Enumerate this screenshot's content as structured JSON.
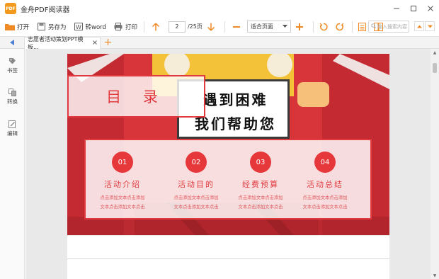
{
  "app": {
    "logo_text": "PDF",
    "title": "金舟PDF阅读器",
    "window_controls": [
      "minimize",
      "maximize",
      "close"
    ]
  },
  "toolbar": {
    "open_label": "打开",
    "save_as_label": "另存为",
    "to_word_label": "转word",
    "print_label": "打印",
    "current_page": "2",
    "total_pages": "/25页",
    "zoom_value": "适合页面",
    "search_placeholder": "输入搜索内容"
  },
  "tabs": {
    "items": [
      {
        "label": "志愿者活动策划PPT模板..."
      }
    ]
  },
  "sidebar": {
    "items": [
      {
        "label": "书签",
        "icon": "bookmark-icon"
      },
      {
        "label": "转换",
        "icon": "convert-icon"
      },
      {
        "label": "编辑",
        "icon": "edit-icon"
      }
    ]
  },
  "slide": {
    "toc_title": "目 录",
    "sign_line1": "遇到困难",
    "sign_line2": "我们帮助您",
    "sections": [
      {
        "num": "01",
        "title": "活动介绍",
        "desc1": "点击添加文本点击添加",
        "desc2": "文本点击添加文本点击"
      },
      {
        "num": "02",
        "title": "活动目的",
        "desc1": "点击添加文本点击添加",
        "desc2": "文本点击添加文本点击"
      },
      {
        "num": "03",
        "title": "经费预算",
        "desc1": "点击添加文本点击添加",
        "desc2": "文本点击添加文本点击"
      },
      {
        "num": "04",
        "title": "活动总结",
        "desc1": "点击添加文本点击添加",
        "desc2": "文本点击添加文本点击"
      }
    ]
  },
  "colors": {
    "accent_orange": "#f08a24",
    "slide_red": "#e03a3e",
    "tab_blue": "#4a7fd4"
  }
}
